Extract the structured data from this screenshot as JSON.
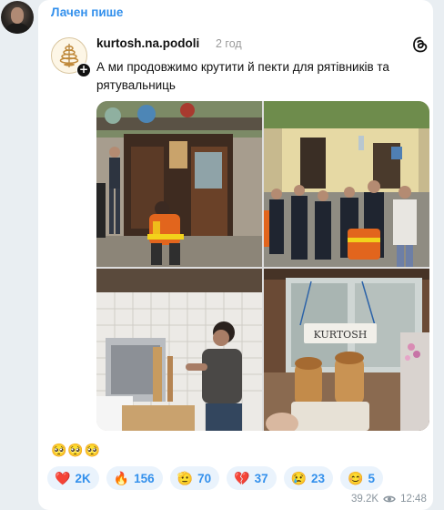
{
  "message": {
    "sender_name": "Лачен пише",
    "emoji_line": "🥺🥺🥺",
    "views": "39.2K",
    "time": "12:48"
  },
  "post": {
    "username": "kurtosh.na.podoli",
    "time_ago": "2 год",
    "text": "А ми продовжимо крутити й пекти для рятівників та рятувальниць",
    "sign_text": "KURTOSH"
  },
  "reactions": [
    {
      "emoji": "❤️",
      "count": "2K",
      "icon": "heart-icon"
    },
    {
      "emoji": "🔥",
      "count": "156",
      "icon": "fire-icon"
    },
    {
      "emoji": "🫡",
      "count": "70",
      "icon": "salute-icon"
    },
    {
      "emoji": "💔",
      "count": "37",
      "icon": "broken-heart-icon"
    },
    {
      "emoji": "😢",
      "count": "23",
      "icon": "crying-face-icon"
    },
    {
      "emoji": "😊",
      "count": "5",
      "icon": "smiling-face-icon"
    }
  ],
  "colors": {
    "accent": "#3390ec",
    "background": "#e9eef2",
    "reaction_bg": "#eaf3fc",
    "rescuer_orange": "#e2651d"
  }
}
